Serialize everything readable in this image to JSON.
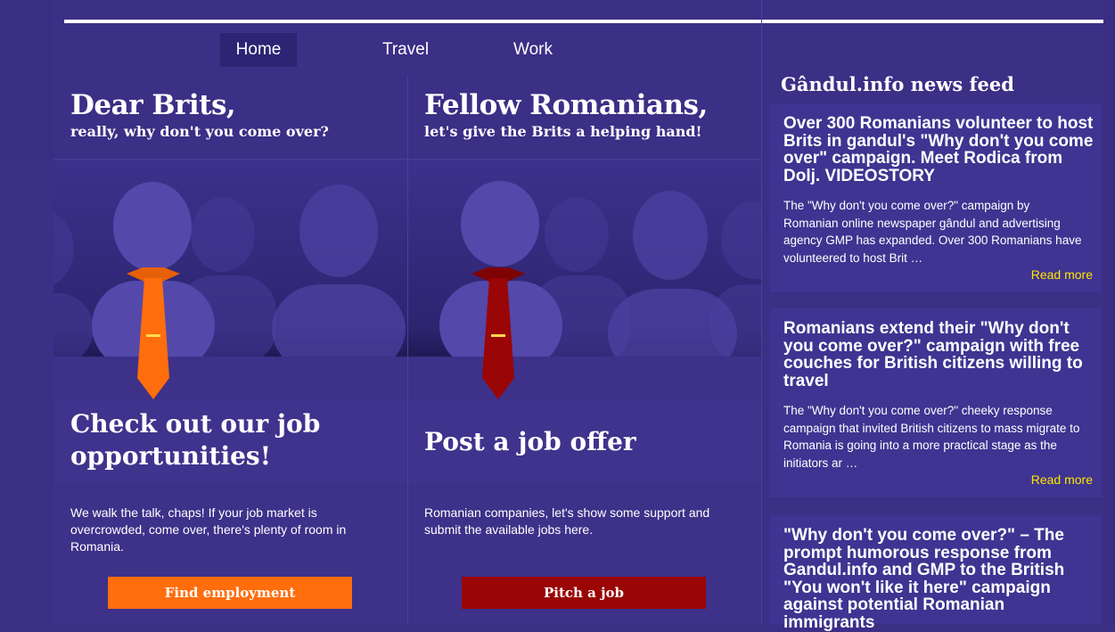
{
  "nav": {
    "items": [
      "Home",
      "Travel",
      "Work"
    ]
  },
  "brits_panel": {
    "headline": "Dear Brits,",
    "subheadline": "really, why don't you come over?",
    "cta_title": "Check out our job opportunities!",
    "description": "We walk the talk, chaps! If your job market is overcrowded, come over, there's plenty of room in Romania.",
    "button": "Find employment",
    "tie_color": "#ff6d0d"
  },
  "romanians_panel": {
    "headline": "Fellow Romanians,",
    "subheadline": "let's give the Brits a helping hand!",
    "cta_title": "Post a job offer",
    "description": "Romanian companies, let's show some support and submit the available jobs here.",
    "button": "Pitch a job",
    "tie_color": "#9a0505"
  },
  "news_feed": {
    "title": "Gândul.info news feed",
    "items": [
      {
        "headline": "Over 300 Romanians volunteer to host Brits in gandul's \"Why don't you come over\" campaign. Meet Rodica from Dolj. VIDEOSTORY",
        "excerpt": "The \"Why don't you come over?\" campaign by Romanian online newspaper gândul and advertising agency GMP has expanded. Over 300 Romanians have volunteered to host Brit …",
        "more": "Read more"
      },
      {
        "headline": "Romanians extend their \"Why don't you come over?\" campaign with free couches for British citizens willing to travel",
        "excerpt": "The \"Why don't you come over?\" cheeky response campaign that invited British citizens to mass migrate to Romania is going into a more practical stage as the initiators ar …",
        "more": "Read more"
      },
      {
        "headline": "\"Why don't you come over?\" – The prompt humorous response from Gandul.info and GMP to the British \"You won't like it here\" campaign against potential Romanian immigrants"
      }
    ]
  }
}
